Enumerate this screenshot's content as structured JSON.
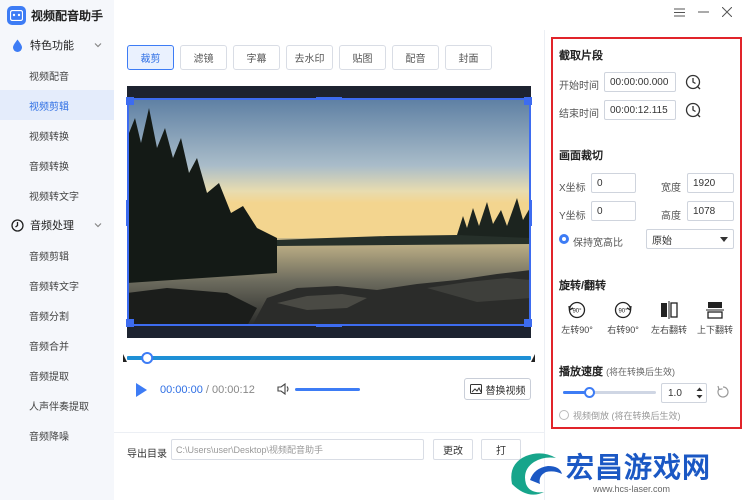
{
  "app": {
    "title": "视频配音助手",
    "accent_color": "#3d7cf5",
    "highlight_color": "#e1242a"
  },
  "window_controls": [
    "menu-icon",
    "minimize-icon",
    "close-icon"
  ],
  "sidebar": {
    "sections": [
      {
        "label": "特色功能",
        "icon": "droplet-icon",
        "items": [
          "视频配音",
          "视频剪辑",
          "视频转换",
          "音频转换",
          "视频转文字"
        ]
      },
      {
        "label": "音频处理",
        "icon": "clock-icon",
        "items": [
          "音频剪辑",
          "音频转文字",
          "音频分割",
          "音频合并",
          "音频提取",
          "人声伴奏提取",
          "音频降噪"
        ]
      }
    ],
    "active_item": "视频剪辑"
  },
  "tabs": [
    "裁剪",
    "滤镜",
    "字幕",
    "去水印",
    "贴图",
    "配音",
    "封面"
  ],
  "active_tab": "裁剪",
  "player": {
    "current_time": "00:00:00",
    "separator": " / ",
    "total_time": "00:00:12",
    "replace_label": "替换视频",
    "progress": 0.05
  },
  "export": {
    "label": "导出目录",
    "path": "C:\\Users\\user\\Desktop\\视频配音助手",
    "change_label": "更改",
    "open_label": "打"
  },
  "right_panel": {
    "clip": {
      "title": "截取片段",
      "start_label": "开始时间",
      "start_value": "00:00:00.000",
      "end_label": "结束时间",
      "end_value": "00:00:12.115"
    },
    "crop": {
      "title": "画面裁切",
      "x_label": "X坐标",
      "x_value": "0",
      "y_label": "Y坐标",
      "y_value": "0",
      "width_label": "宽度",
      "width_value": "1920",
      "height_label": "高度",
      "height_value": "1078",
      "keep_ratio_label": "保持宽高比",
      "keep_ratio_checked": true,
      "ratio_select": "原始"
    },
    "rotate": {
      "title": "旋转/翻转",
      "items": [
        "左转90°",
        "右转90°",
        "左右翻转",
        "上下翻转"
      ],
      "icon_text": "90°"
    },
    "speed": {
      "title": "播放速度",
      "note": "(将在转换后生效)",
      "value": "1.0",
      "level": 0.28,
      "reverse_label": "视频倒放",
      "reverse_note": "(将在转换后生效)"
    }
  },
  "watermark": {
    "title": "宏昌游戏网",
    "url": "www.hcs-laser.com"
  }
}
